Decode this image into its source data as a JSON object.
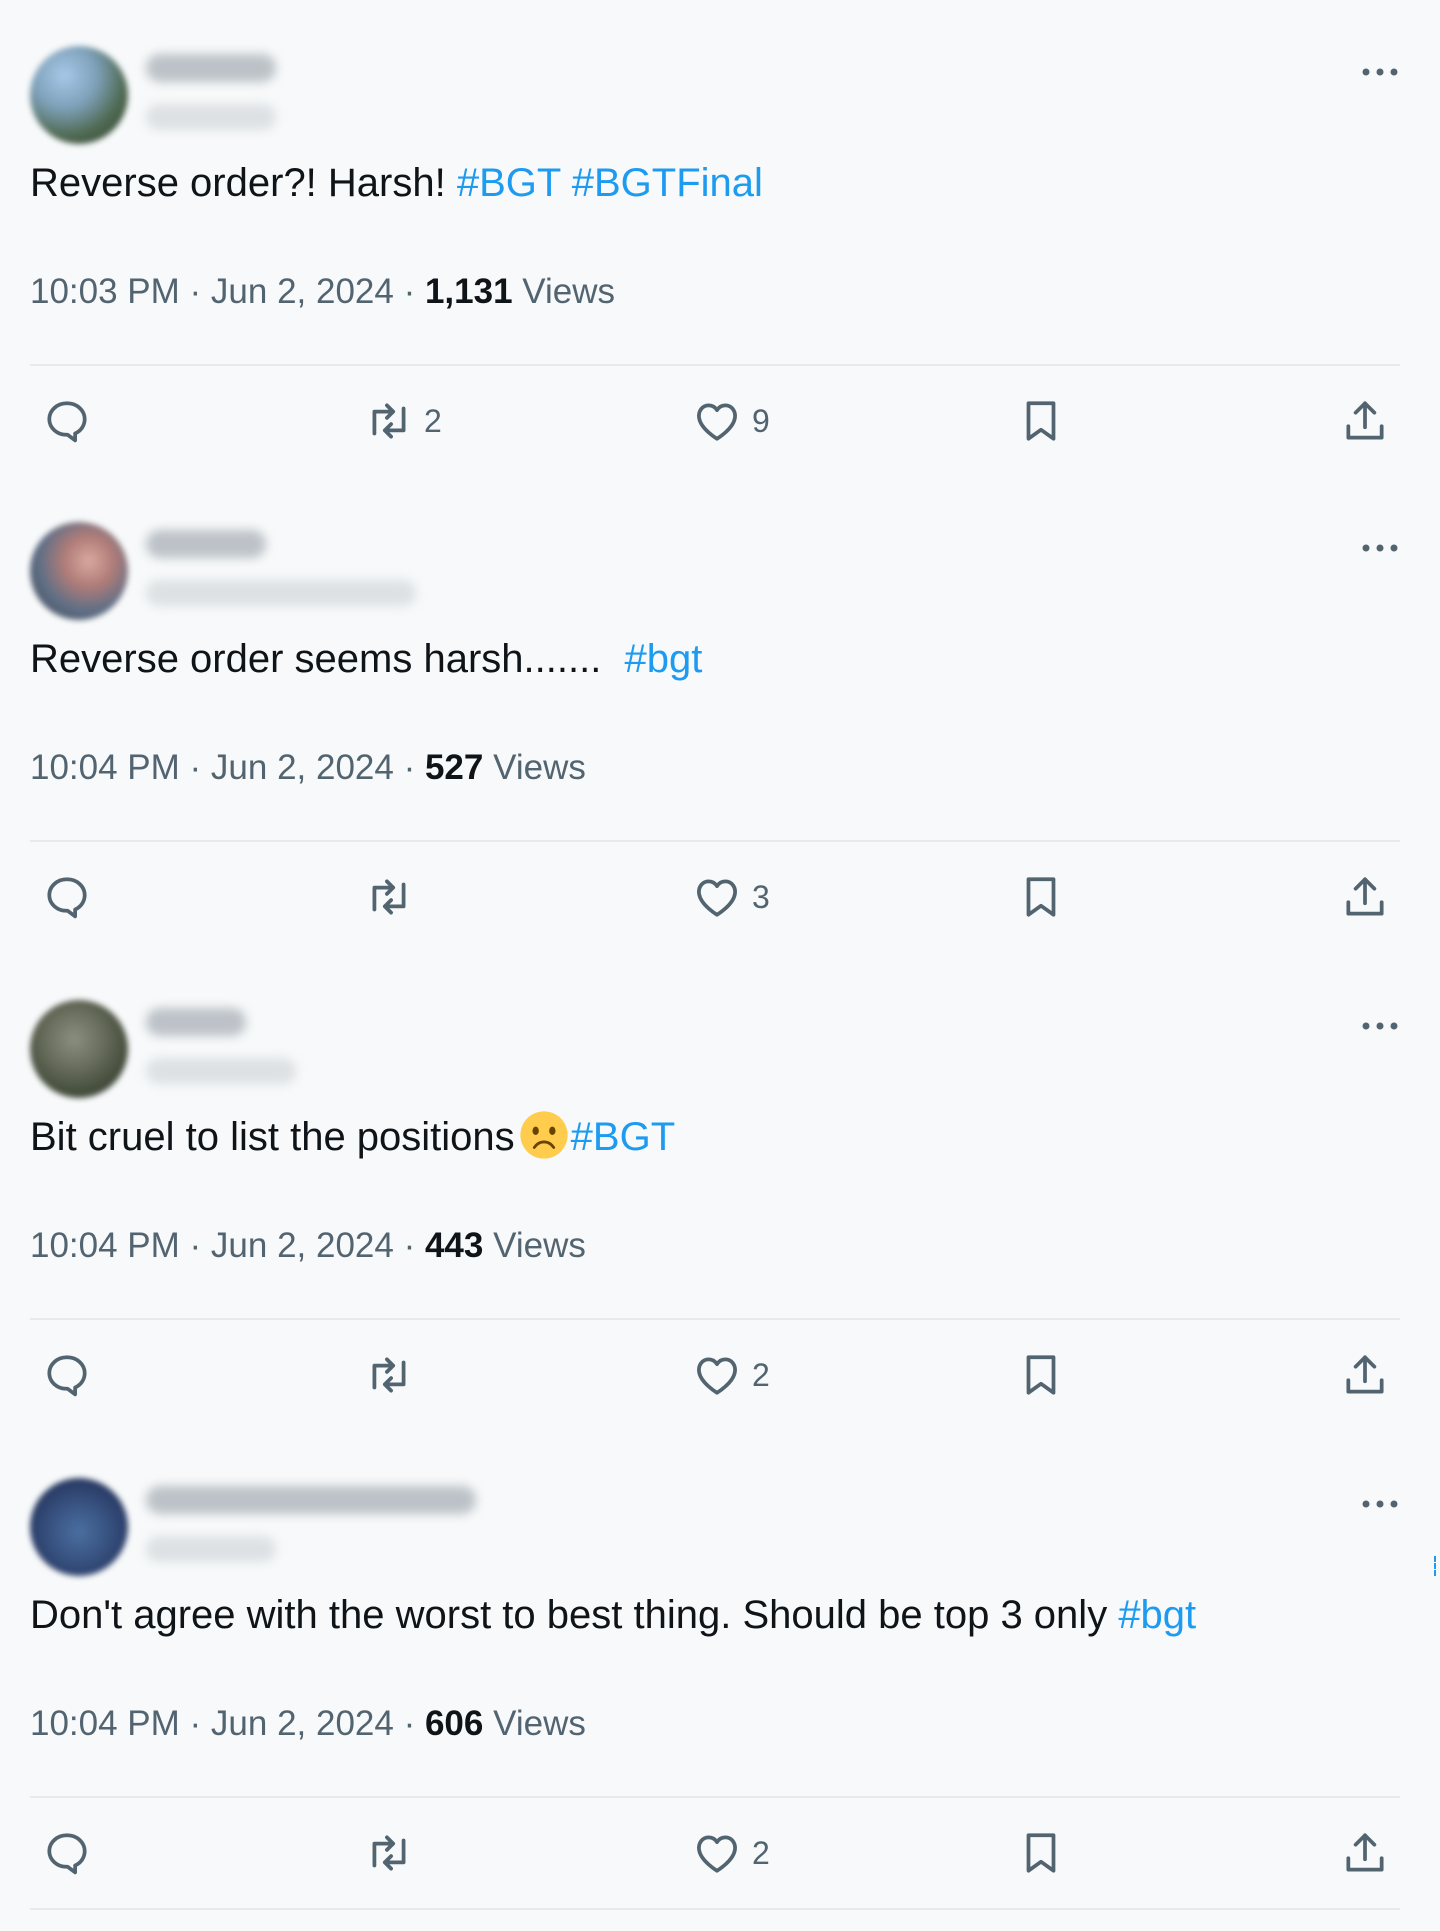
{
  "tweets": [
    {
      "text": "Reverse order?! Harsh!",
      "hashtags": [
        "#BGT",
        "#BGTFinal"
      ],
      "time": "10:03 PM",
      "date": "Jun 2, 2024",
      "views": "1,131",
      "views_label": "Views",
      "replies": "",
      "retweets": "2",
      "likes": "9"
    },
    {
      "text": "Reverse order seems harsh.......",
      "hashtags": [
        "#bgt"
      ],
      "time": "10:04 PM",
      "date": "Jun 2, 2024",
      "views": "527",
      "views_label": "Views",
      "replies": "",
      "retweets": "",
      "likes": "3"
    },
    {
      "text": "Bit cruel to list the positions",
      "emoji": "frowning-face",
      "hashtags": [
        "#BGT"
      ],
      "time": "10:04 PM",
      "date": "Jun 2, 2024",
      "views": "443",
      "views_label": "Views",
      "replies": "",
      "retweets": "",
      "likes": "2"
    },
    {
      "text": "Don't agree with the worst to best thing. Should be top 3 only",
      "hashtags": [
        "#bgt"
      ],
      "time": "10:04 PM",
      "date": "Jun 2, 2024",
      "views": "606",
      "views_label": "Views",
      "replies": "",
      "retweets": "",
      "likes": "2"
    }
  ],
  "separator": " · ",
  "colors": {
    "link": "#1d9bf0",
    "meta": "#536471",
    "text": "#0f1419"
  },
  "icons": [
    "reply-icon",
    "retweet-icon",
    "like-icon",
    "bookmark-icon",
    "share-icon",
    "more-icon"
  ]
}
